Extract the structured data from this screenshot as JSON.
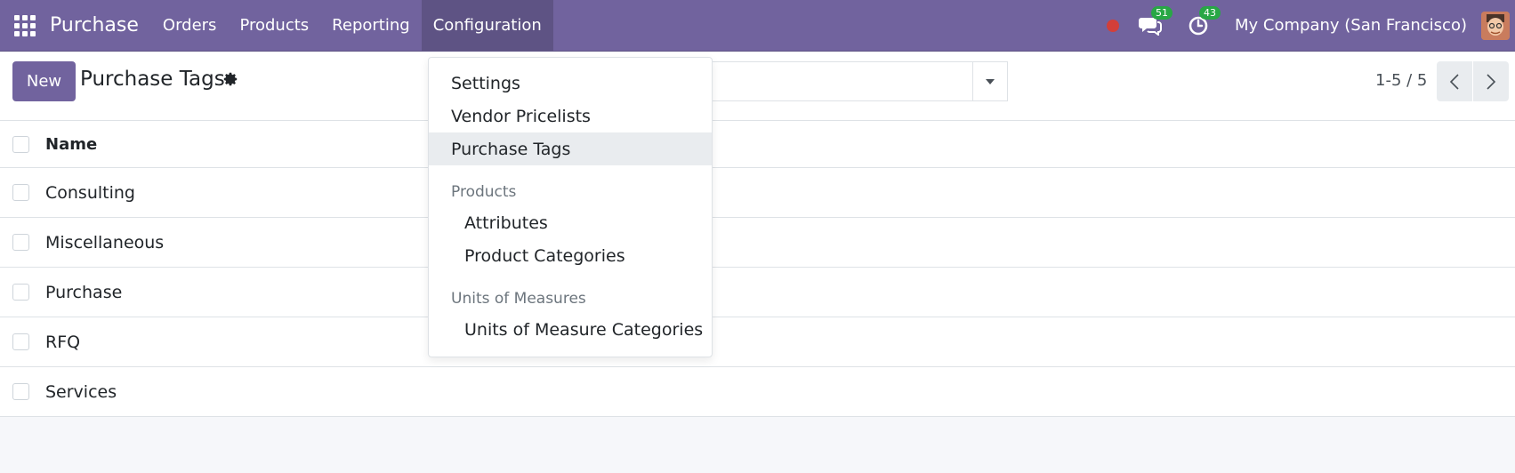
{
  "navbar": {
    "brand": "Purchase",
    "menu": [
      "Orders",
      "Products",
      "Reporting",
      "Configuration"
    ],
    "messages_badge": "51",
    "activities_badge": "43",
    "company": "My Company (San Francisco)"
  },
  "control": {
    "new_label": "New",
    "title": "Purchase Tags",
    "pager": "1-5 / 5"
  },
  "list": {
    "header": "Name",
    "rows": [
      "Consulting",
      "Miscellaneous",
      "Purchase",
      "RFQ",
      "Services"
    ]
  },
  "dropdown": {
    "top_items": [
      "Settings",
      "Vendor Pricelists",
      "Purchase Tags"
    ],
    "products_header": "Products",
    "products_items": [
      "Attributes",
      "Product Categories"
    ],
    "uom_header": "Units of Measures",
    "uom_items": [
      "Units of Measure Categories"
    ]
  },
  "colors": {
    "brand": "#71639e",
    "badge": "#28a745",
    "recording": "#d23f3a"
  }
}
